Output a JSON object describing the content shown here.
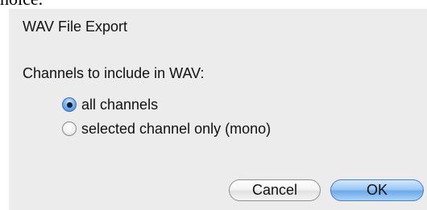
{
  "background_text": "hoice.",
  "dialog": {
    "title": "WAV File Export",
    "prompt": "Channels to include in WAV:",
    "options": [
      {
        "label": "all channels",
        "selected": true
      },
      {
        "label": "selected channel only (mono)",
        "selected": false
      }
    ],
    "buttons": {
      "cancel_label": "Cancel",
      "ok_label": "OK"
    }
  },
  "colors": {
    "dialog_background": "#ececec",
    "default_button": "#6ea9e8"
  }
}
